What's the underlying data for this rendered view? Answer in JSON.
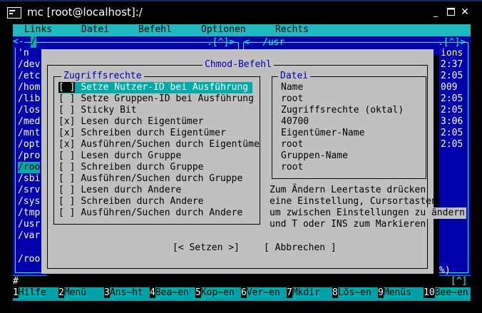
{
  "window": {
    "title": "mc [root@localhost]:/"
  },
  "menubar": [
    "Links",
    "Datei",
    "Befehl",
    "Optionen",
    "Rechts"
  ],
  "left_panel": {
    "header_left": "<-",
    "header_path": "/",
    "header_right": ".[^]>",
    "files": [
      "'n",
      "/dev",
      "/etc",
      "/hom",
      "/lib",
      "/los",
      "/med",
      "/mnt",
      "/opt",
      "/pro",
      "/roo",
      "/sbi",
      "/srv",
      "/sys",
      "/tmp",
      "/usr",
      "/var"
    ],
    "selected_index": 10,
    "status": "/roo"
  },
  "right_panel": {
    "header_left": "<-",
    "header_path": "/usr",
    "header_right": ".[^]>",
    "col_header": "ions",
    "times": [
      "2:37",
      "2:05",
      "009",
      "2:05",
      "2:05",
      "3:06",
      "2:05",
      "2:05"
    ]
  },
  "dialog": {
    "title": "Chmod-Befehl",
    "perms_title": "Zugriffsrechte",
    "perms": [
      {
        "mark": "[ ]",
        "label": "Setze Nutzer-ID bei Ausführung",
        "selected": true
      },
      {
        "mark": "[ ]",
        "label": "Setze Gruppen-ID bei Ausführung"
      },
      {
        "mark": "[ ]",
        "label": "Sticky Bit"
      },
      {
        "mark": "[x]",
        "label": "Lesen durch Eigentümer"
      },
      {
        "mark": "[x]",
        "label": "Schreiben durch Eigentümer"
      },
      {
        "mark": "[x]",
        "label": "Ausführen/Suchen durch Eigentüme"
      },
      {
        "mark": "[ ]",
        "label": "Lesen durch Gruppe"
      },
      {
        "mark": "[ ]",
        "label": "Schreiben durch Gruppe"
      },
      {
        "mark": "[ ]",
        "label": "Ausführen/Suchen durch Gruppe"
      },
      {
        "mark": "[ ]",
        "label": "Lesen durch Andere"
      },
      {
        "mark": "[ ]",
        "label": "Schreiben durch Andere"
      },
      {
        "mark": "[ ]",
        "label": "Ausführen/Suchen durch Andere"
      }
    ],
    "file_title": "Datei",
    "file_lines": [
      "Name",
      "root",
      "Zugriffsrechte (oktal)",
      "40700",
      "Eigentümer-Name",
      "root",
      "Gruppen-Name",
      "root"
    ],
    "help_lines": [
      "Zum Ändern Leertaste drücken",
      "eine Einstellung, Cursortasten",
      "um zwischen Einstellungen zu ändern",
      "und T oder INS zum Markieren"
    ],
    "buttons": {
      "set": "[< Setzen >]",
      "cancel": "[ Abbrechen ]"
    }
  },
  "cmdline": {
    "prompt": "#",
    "right_hint": "[^]",
    "percent": "%)"
  },
  "fkeys": [
    {
      "n": "1",
      "l": "Hilfe"
    },
    {
      "n": "2",
      "l": "Menü"
    },
    {
      "n": "3",
      "l": "Ans~ht"
    },
    {
      "n": "4",
      "l": "Bea~en"
    },
    {
      "n": "5",
      "l": "Kop~en"
    },
    {
      "n": "6",
      "l": "Ver~en"
    },
    {
      "n": "7",
      "l": "Mkdir"
    },
    {
      "n": "8",
      "l": "Lös~en"
    },
    {
      "n": "9",
      "l": "Menüs"
    },
    {
      "n": "10",
      "l": "Bee~en"
    }
  ],
  "colors": {
    "cyan_bg": "#00a0a8",
    "panel_blue": "#0000aa",
    "dialog_gray": "#c0c0c0",
    "select_cyan": "#00aaaa"
  }
}
